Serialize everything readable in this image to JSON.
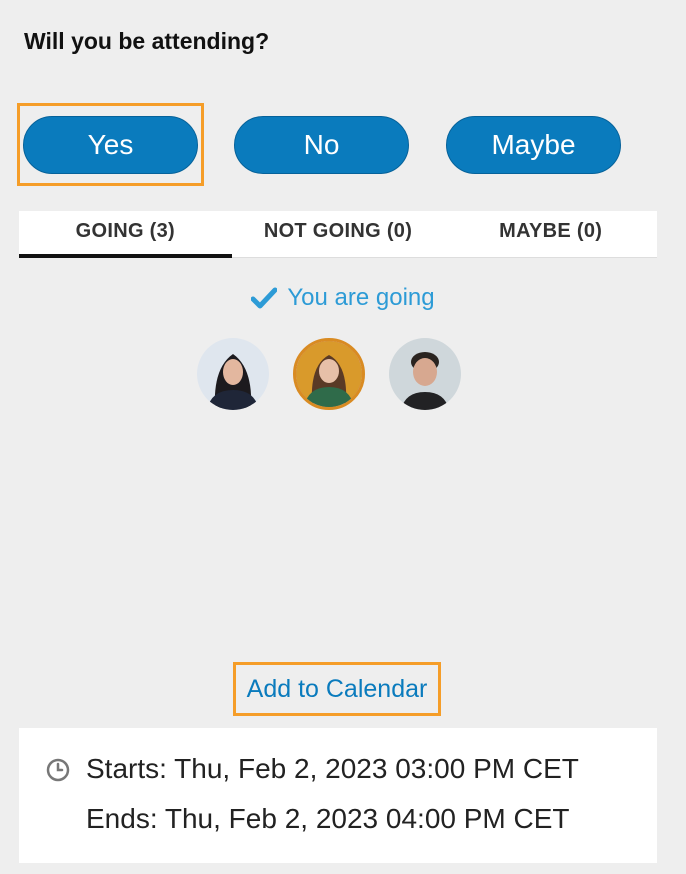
{
  "question": "Will you be attending?",
  "rsvp": {
    "yes_label": "Yes",
    "no_label": "No",
    "maybe_label": "Maybe"
  },
  "tabs": [
    {
      "label": "GOING (3)",
      "active": true
    },
    {
      "label": "NOT GOING (0)",
      "active": false
    },
    {
      "label": "MAYBE (0)",
      "active": false
    }
  ],
  "status": {
    "text": "You are going",
    "icon": "check-icon"
  },
  "attendees": [
    {
      "icon": "avatar-woman-dark-hair"
    },
    {
      "icon": "avatar-woman-colorful-border"
    },
    {
      "icon": "avatar-man"
    }
  ],
  "calendar": {
    "link_label": "Add to Calendar"
  },
  "event_time": {
    "icon": "clock-icon",
    "starts": "Starts: Thu, Feb 2, 2023 03:00 PM CET",
    "ends": "Ends: Thu, Feb 2, 2023 04:00 PM CET"
  },
  "colors": {
    "button": "#0a7bbd",
    "highlight": "#f59d28",
    "status": "#2d9bd6",
    "background": "#eeeeee"
  }
}
